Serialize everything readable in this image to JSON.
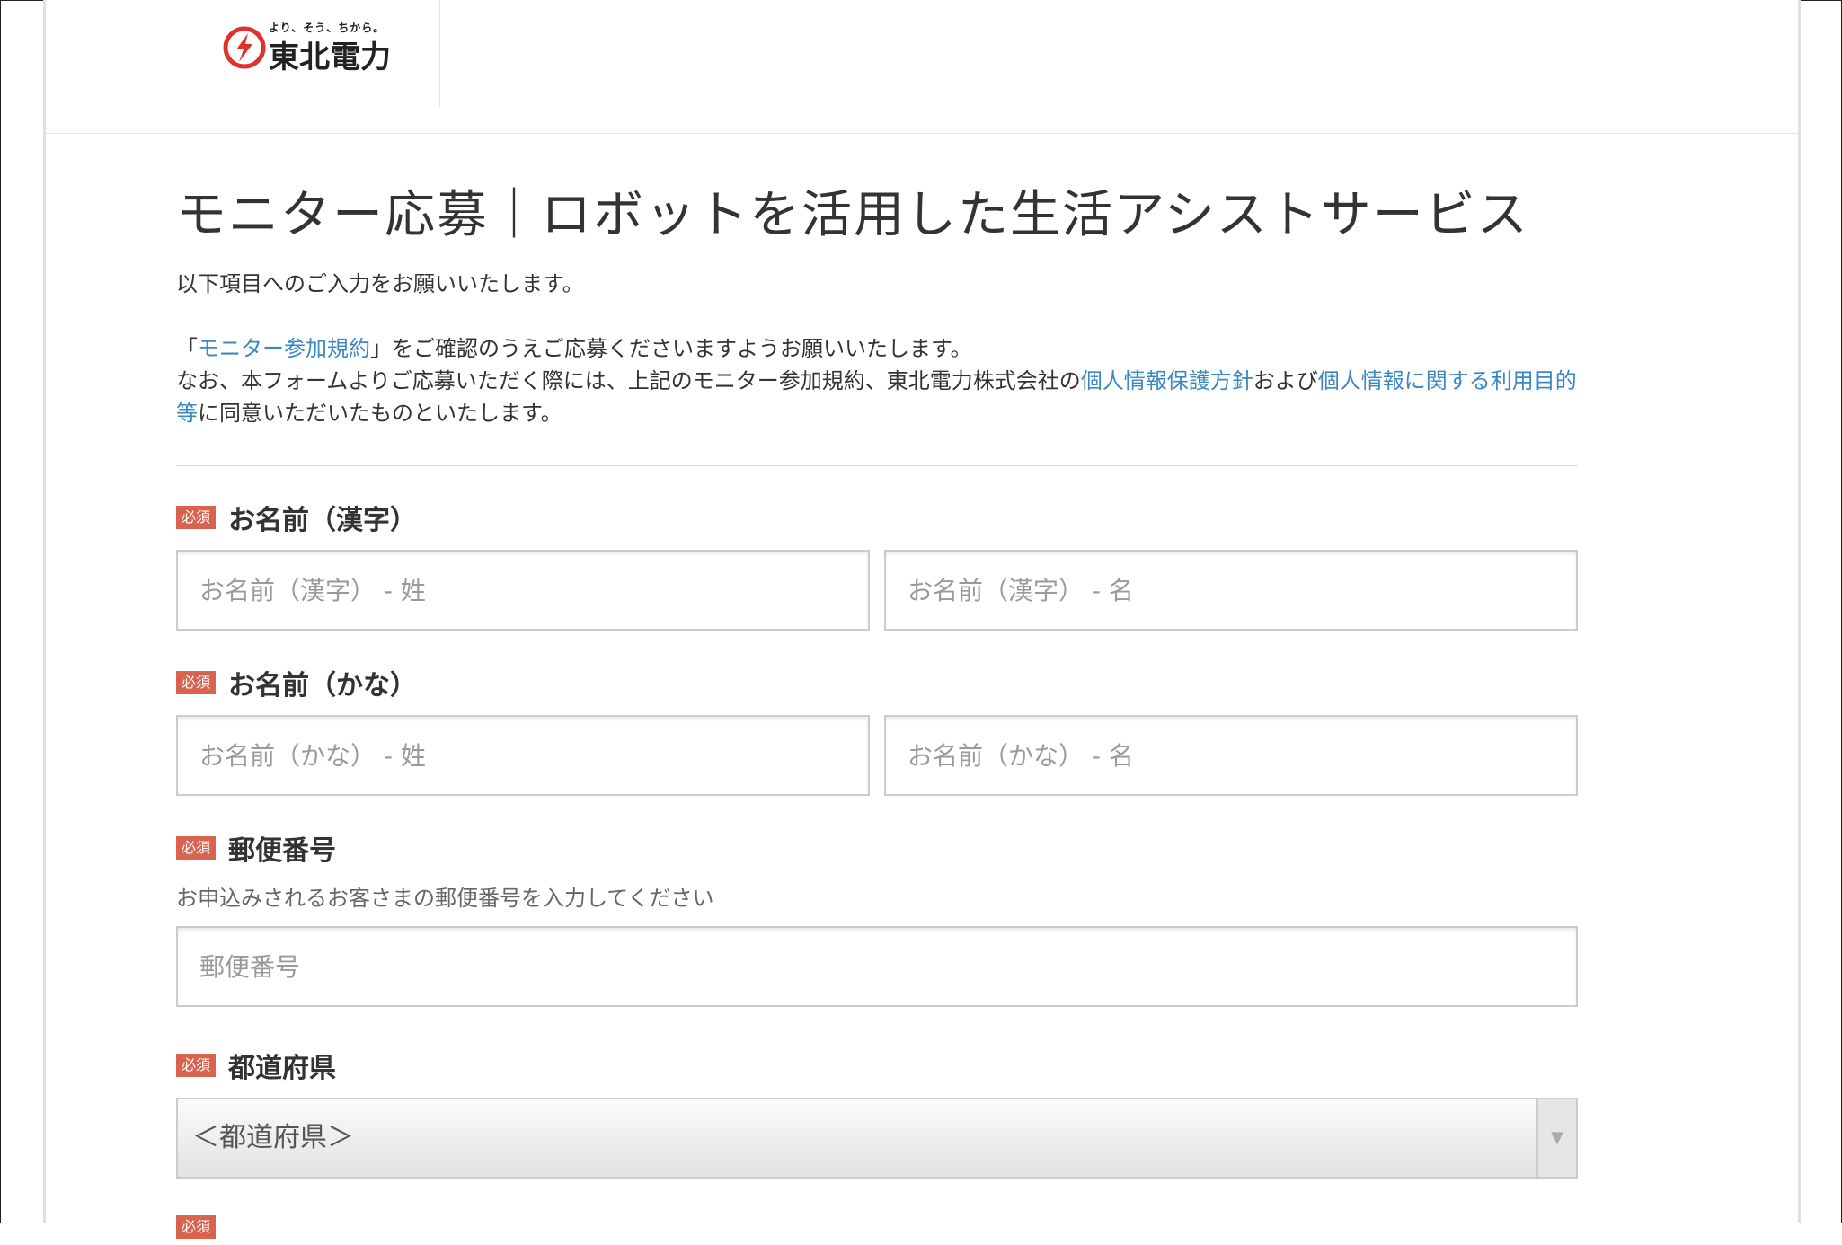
{
  "header": {
    "logo_tagline": "より、そう、ちから。",
    "logo_name": "東北電力"
  },
  "page_title": "モニター応募｜ロボットを活用した生活アシストサービス",
  "intro": {
    "line1": "以下項目へのご入力をお願いいたします。",
    "line2_prefix": "「",
    "line2_link": "モニター参加規約",
    "line2_suffix": "」をご確認のうえご応募くださいますようお願いいたします。",
    "line3_prefix": "なお、本フォームよりご応募いただく際には、上記のモニター参加規約、東北電力株式会社の",
    "line3_link1": "個人情報保護方針",
    "line3_mid": "および",
    "line3_link2": "個人情報に関する利用目的等",
    "line3_suffix": "に同意いただいたものといたします。"
  },
  "required_badge": "必須",
  "fields": {
    "name_kanji": {
      "label": "お名前（漢字）",
      "last_placeholder": "お名前（漢字） - 姓",
      "first_placeholder": "お名前（漢字） - 名"
    },
    "name_kana": {
      "label": "お名前（かな）",
      "last_placeholder": "お名前（かな） - 姓",
      "first_placeholder": "お名前（かな） - 名"
    },
    "postal_code": {
      "label": "郵便番号",
      "help": "お申込みされるお客さまの郵便番号を入力してください",
      "placeholder": "郵便番号"
    },
    "prefecture": {
      "label": "都道府県",
      "selected": "＜都道府県＞"
    }
  },
  "colors": {
    "link": "#3b88c3",
    "required_badge": "#d9634f",
    "logo_red": "#e0322d"
  }
}
